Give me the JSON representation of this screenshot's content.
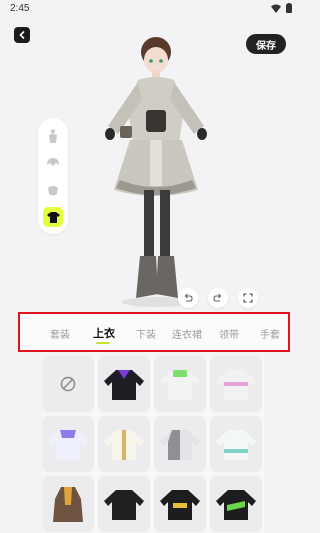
{
  "status": {
    "time": "2:45"
  },
  "header": {
    "save_label": "保存"
  },
  "side_panel": {
    "items": [
      {
        "icon": "body-icon",
        "active": false
      },
      {
        "icon": "hair-icon",
        "active": false
      },
      {
        "icon": "face-icon",
        "active": false
      },
      {
        "icon": "tshirt-icon",
        "active": true
      }
    ]
  },
  "view_controls": [
    "undo-icon",
    "redo-icon",
    "fullscreen-icon"
  ],
  "tabs": [
    {
      "label": "套装",
      "active": false
    },
    {
      "label": "上衣",
      "active": true
    },
    {
      "label": "下装",
      "active": false
    },
    {
      "label": "连衣裙",
      "active": false
    },
    {
      "label": "领带",
      "active": false
    },
    {
      "label": "手套",
      "active": false
    }
  ],
  "colors": {
    "accent": "#e4ff3c",
    "highlight_border": "#e0161c",
    "dark": "#222222"
  },
  "grid": {
    "items": [
      "none-icon",
      "purple-black-jacket",
      "green-white-hoodie",
      "pink-white-jacket",
      "lavender-white-top",
      "white-gold-top",
      "white-grey-jacket",
      "mint-white-top",
      "brown-dress-top",
      "black-leather-jacket",
      "black-yellow-top",
      "black-green-top"
    ]
  }
}
